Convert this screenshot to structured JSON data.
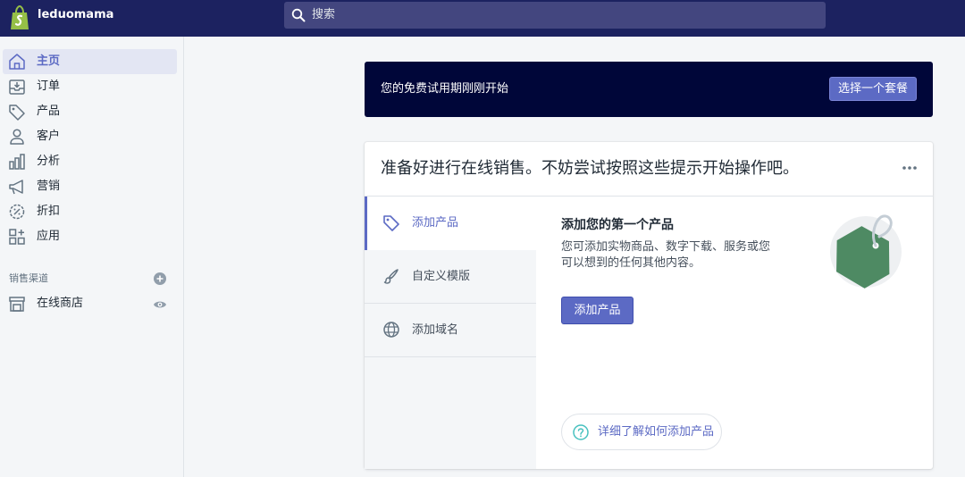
{
  "topbar": {
    "store_name": "leduomama",
    "search_placeholder": "搜索",
    "icons": [
      "shopify-bag-icon",
      "search-icon"
    ],
    "colors": {
      "background": "#1c2260",
      "search_background": "#43467f"
    }
  },
  "sidebar": {
    "items": [
      {
        "label": "主页",
        "icon": "home-icon",
        "active": true
      },
      {
        "label": "订单",
        "icon": "orders-icon",
        "active": false
      },
      {
        "label": "产品",
        "icon": "tag-icon",
        "active": false
      },
      {
        "label": "客户",
        "icon": "customer-icon",
        "active": false
      },
      {
        "label": "分析",
        "icon": "analytics-icon",
        "active": false
      },
      {
        "label": "营销",
        "icon": "megaphone-icon",
        "active": false
      },
      {
        "label": "折扣",
        "icon": "discount-icon",
        "active": false
      },
      {
        "label": "应用",
        "icon": "apps-icon",
        "active": false
      }
    ],
    "sales_channels": {
      "title": "销售渠道",
      "add_icon": "plus-circle-icon",
      "channels": [
        {
          "label": "在线商店",
          "icon": "storefront-icon",
          "action_icon": "eye-icon"
        }
      ]
    }
  },
  "banner": {
    "text": "您的免费试用期刚刚开始",
    "button": "选择一个套餐",
    "colors": {
      "background": "#000639",
      "button": "#5c6ac4"
    }
  },
  "setup_card": {
    "title": "准备好进行在线销售。不妨尝试按照这些提示开始操作吧。",
    "more_icon": "more-horizontal-icon",
    "tabs": [
      {
        "label": "添加产品",
        "icon": "tag-icon",
        "active": true
      },
      {
        "label": "自定义模版",
        "icon": "paintbrush-icon",
        "active": false
      },
      {
        "label": "添加域名",
        "icon": "globe-icon",
        "active": false
      }
    ],
    "panel": {
      "title": "添加您的第一个产品",
      "description": "您可添加实物商品、数字下载、服务或您可以想到的任何其他内容。",
      "button": "添加产品",
      "illustration": "product-tag-illustration",
      "help_icon": "question-circle-icon",
      "help_link": "详细了解如何添加产品"
    },
    "colors": {
      "accent": "#5c6ac4",
      "tag_green": "#4e8a63"
    }
  }
}
